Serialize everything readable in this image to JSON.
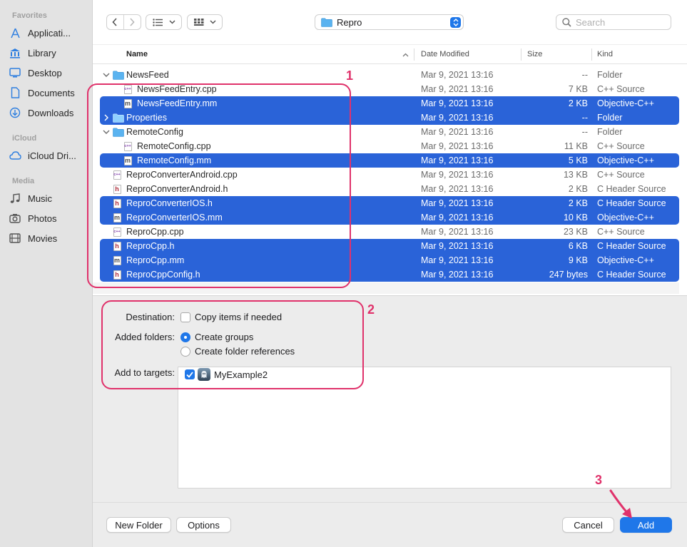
{
  "sidebar": {
    "sections": [
      {
        "title": "Favorites",
        "items": [
          {
            "label": "Applicati...",
            "icon": "applications-icon"
          },
          {
            "label": "Library",
            "icon": "library-icon"
          },
          {
            "label": "Desktop",
            "icon": "desktop-icon"
          },
          {
            "label": "Documents",
            "icon": "document-icon"
          },
          {
            "label": "Downloads",
            "icon": "downloads-icon"
          }
        ]
      },
      {
        "title": "iCloud",
        "items": [
          {
            "label": "iCloud Dri...",
            "icon": "cloud-icon"
          }
        ]
      },
      {
        "title": "Media",
        "items": [
          {
            "label": "Music",
            "icon": "music-icon"
          },
          {
            "label": "Photos",
            "icon": "camera-icon"
          },
          {
            "label": "Movies",
            "icon": "film-icon"
          }
        ]
      }
    ]
  },
  "toolbar": {
    "location": "Repro",
    "search_placeholder": "Search"
  },
  "columns": {
    "name": "Name",
    "date": "Date Modified",
    "size": "Size",
    "kind": "Kind"
  },
  "files": [
    {
      "name": "NewsFeed",
      "date": "Mar 9, 2021 13:16",
      "size": "--",
      "kind": "Folder",
      "type": "folder",
      "indent": 0,
      "disclosure": "open",
      "selected": false
    },
    {
      "name": "NewsFeedEntry.cpp",
      "date": "Mar 9, 2021 13:16",
      "size": "7 KB",
      "kind": "C++ Source",
      "type": "cpp",
      "indent": 1,
      "selected": false
    },
    {
      "name": "NewsFeedEntry.mm",
      "date": "Mar 9, 2021 13:16",
      "size": "2 KB",
      "kind": "Objective-C++",
      "type": "m",
      "indent": 1,
      "selected": true
    },
    {
      "name": "Properties",
      "date": "Mar 9, 2021 13:16",
      "size": "--",
      "kind": "Folder",
      "type": "folder",
      "indent": 0,
      "disclosure": "closed",
      "selected": true
    },
    {
      "name": "RemoteConfig",
      "date": "Mar 9, 2021 13:16",
      "size": "--",
      "kind": "Folder",
      "type": "folder",
      "indent": 0,
      "disclosure": "open",
      "selected": false
    },
    {
      "name": "RemoteConfig.cpp",
      "date": "Mar 9, 2021 13:16",
      "size": "11 KB",
      "kind": "C++ Source",
      "type": "cpp",
      "indent": 1,
      "selected": false
    },
    {
      "name": "RemoteConfig.mm",
      "date": "Mar 9, 2021 13:16",
      "size": "5 KB",
      "kind": "Objective-C++",
      "type": "m",
      "indent": 1,
      "selected": true
    },
    {
      "name": "ReproConverterAndroid.cpp",
      "date": "Mar 9, 2021 13:16",
      "size": "13 KB",
      "kind": "C++ Source",
      "type": "cpp",
      "indent": 0,
      "selected": false
    },
    {
      "name": "ReproConverterAndroid.h",
      "date": "Mar 9, 2021 13:16",
      "size": "2 KB",
      "kind": "C Header Source",
      "type": "h",
      "indent": 0,
      "selected": false
    },
    {
      "name": "ReproConverterIOS.h",
      "date": "Mar 9, 2021 13:16",
      "size": "2 KB",
      "kind": "C Header Source",
      "type": "h",
      "indent": 0,
      "selected": true
    },
    {
      "name": "ReproConverterIOS.mm",
      "date": "Mar 9, 2021 13:16",
      "size": "10 KB",
      "kind": "Objective-C++",
      "type": "m",
      "indent": 0,
      "selected": true
    },
    {
      "name": "ReproCpp.cpp",
      "date": "Mar 9, 2021 13:16",
      "size": "23 KB",
      "kind": "C++ Source",
      "type": "cpp",
      "indent": 0,
      "selected": false
    },
    {
      "name": "ReproCpp.h",
      "date": "Mar 9, 2021 13:16",
      "size": "6 KB",
      "kind": "C Header Source",
      "type": "h",
      "indent": 0,
      "selected": true
    },
    {
      "name": "ReproCpp.mm",
      "date": "Mar 9, 2021 13:16",
      "size": "9 KB",
      "kind": "Objective-C++",
      "type": "m",
      "indent": 0,
      "selected": true
    },
    {
      "name": "ReproCppConfig.h",
      "date": "Mar 9, 2021 13:16",
      "size": "247 bytes",
      "kind": "C Header Source",
      "type": "h",
      "indent": 0,
      "selected": true
    }
  ],
  "options": {
    "destination_label": "Destination:",
    "copy_items_label": "Copy items if needed",
    "copy_items_checked": false,
    "added_folders_label": "Added folders:",
    "create_groups_label": "Create groups",
    "create_refs_label": "Create folder references",
    "selected_folder_option": "groups",
    "targets_label": "Add to targets:",
    "target_name": "MyExample2",
    "target_checked": true
  },
  "buttons": {
    "new_folder": "New Folder",
    "options": "Options",
    "cancel": "Cancel",
    "add": "Add"
  },
  "annotations": [
    "1",
    "2",
    "3"
  ],
  "colors": {
    "selection": "#2a63d8",
    "accent": "#1f77e9",
    "annotation": "#e0326b"
  }
}
